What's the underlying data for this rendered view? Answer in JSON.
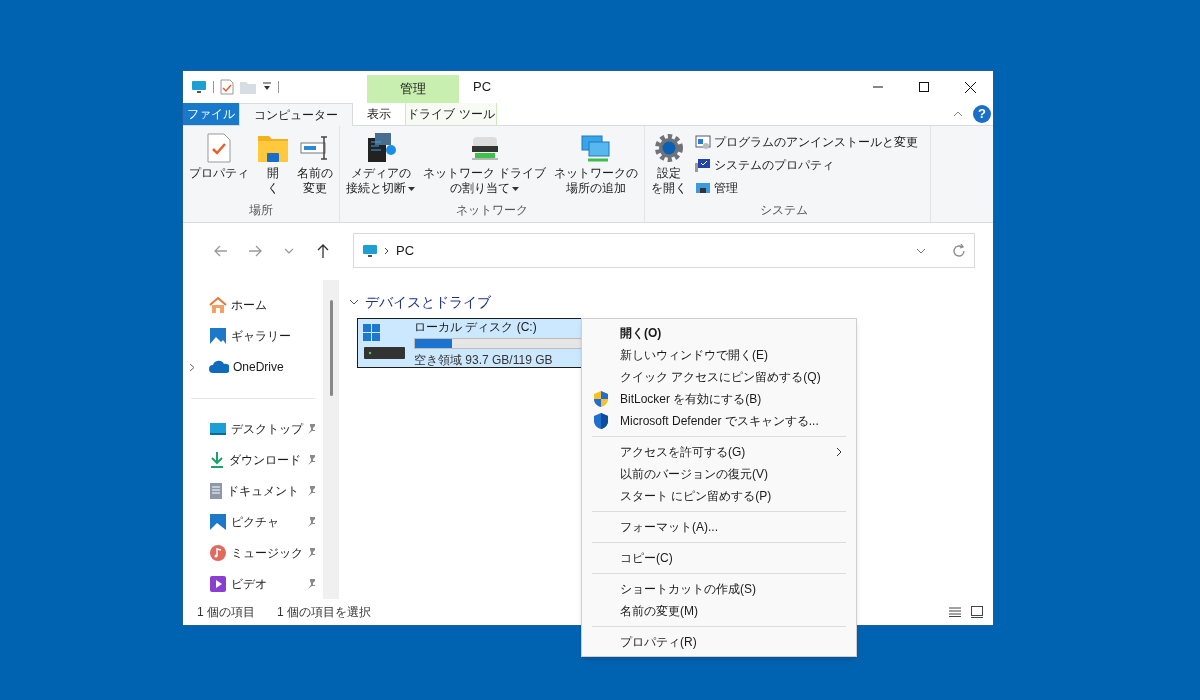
{
  "window": {
    "title": "PC",
    "context_tab": "管理"
  },
  "ribbon_tabs": [
    {
      "label": "ファイル",
      "kind": "file",
      "selected": false
    },
    {
      "label": "コンピューター",
      "kind": "tab",
      "selected": true
    },
    {
      "label": "表示",
      "kind": "tab",
      "selected": false
    },
    {
      "label": "ドライブ ツール",
      "kind": "context",
      "selected": false
    }
  ],
  "ribbon_groups": [
    {
      "label": "場所",
      "commands": [
        {
          "lines": [
            "プロパティ"
          ],
          "dropdown": false
        },
        {
          "lines": [
            "開",
            "く"
          ],
          "dropdown": false
        },
        {
          "lines": [
            "名前の",
            "変更"
          ],
          "dropdown": false
        }
      ]
    },
    {
      "label": "ネットワーク",
      "commands": [
        {
          "lines": [
            "メディアの",
            "接続と切断"
          ],
          "dropdown": true
        },
        {
          "lines": [
            "ネットワーク ドライブ",
            "の割り当て"
          ],
          "dropdown": true
        },
        {
          "lines": [
            "ネットワークの",
            "場所の追加"
          ],
          "dropdown": false
        }
      ]
    },
    {
      "label": "システム",
      "commands": [
        {
          "lines": [
            "設定",
            "を開く"
          ],
          "dropdown": false
        }
      ],
      "small_commands": [
        {
          "label": "プログラムのアンインストールと変更"
        },
        {
          "label": "システムのプロパティ"
        },
        {
          "label": "管理"
        }
      ]
    }
  ],
  "help": "?",
  "address": {
    "path": "PC"
  },
  "nav_groups": [
    [
      {
        "label": "ホーム",
        "pinned": false,
        "expandable": false
      },
      {
        "label": "ギャラリー",
        "pinned": false,
        "expandable": false
      },
      {
        "label": "OneDrive",
        "pinned": false,
        "expandable": true
      }
    ],
    [
      {
        "label": "デスクトップ",
        "pinned": true,
        "expandable": false
      },
      {
        "label": "ダウンロード",
        "pinned": true,
        "expandable": false
      },
      {
        "label": "ドキュメント",
        "pinned": true,
        "expandable": false
      },
      {
        "label": "ピクチャ",
        "pinned": true,
        "expandable": false
      },
      {
        "label": "ミュージック",
        "pinned": true,
        "expandable": false
      },
      {
        "label": "ビデオ",
        "pinned": true,
        "expandable": false
      }
    ]
  ],
  "section": {
    "label": "デバイスとドライブ",
    "expanded": true
  },
  "drives": [
    {
      "name": "ローカル ディスク (C:)",
      "level": 0.21,
      "free": "空き領域 93.7 GB/119 GB",
      "selected": true
    }
  ],
  "status_bar": [
    "1 個の項目",
    "1 個の項目を選択"
  ],
  "context_menu": [
    [
      {
        "label": "開く(O)",
        "kind": "default",
        "submenu": false
      },
      {
        "label": "新しいウィンドウで開く(E)",
        "kind": "item",
        "submenu": false
      },
      {
        "label": "クイック アクセスにピン留めする(Q)",
        "kind": "item",
        "submenu": false
      },
      {
        "label": "BitLocker を有効にする(B)",
        "kind": "item",
        "submenu": false
      },
      {
        "label": "Microsoft Defender でスキャンする...",
        "kind": "item",
        "submenu": false
      }
    ],
    [
      {
        "label": "アクセスを許可する(G)",
        "kind": "item",
        "submenu": true
      },
      {
        "label": "以前のバージョンの復元(V)",
        "kind": "item",
        "submenu": false
      },
      {
        "label": "スタート にピン留めする(P)",
        "kind": "item",
        "submenu": false
      }
    ],
    [
      {
        "label": "フォーマット(A)...",
        "kind": "item",
        "submenu": false
      }
    ],
    [
      {
        "label": "コピー(C)",
        "kind": "item",
        "submenu": false
      }
    ],
    [
      {
        "label": "ショートカットの作成(S)",
        "kind": "item",
        "submenu": false
      },
      {
        "label": "名前の変更(M)",
        "kind": "item",
        "submenu": false
      }
    ],
    [
      {
        "label": "プロパティ(R)",
        "kind": "item",
        "submenu": false
      }
    ]
  ]
}
